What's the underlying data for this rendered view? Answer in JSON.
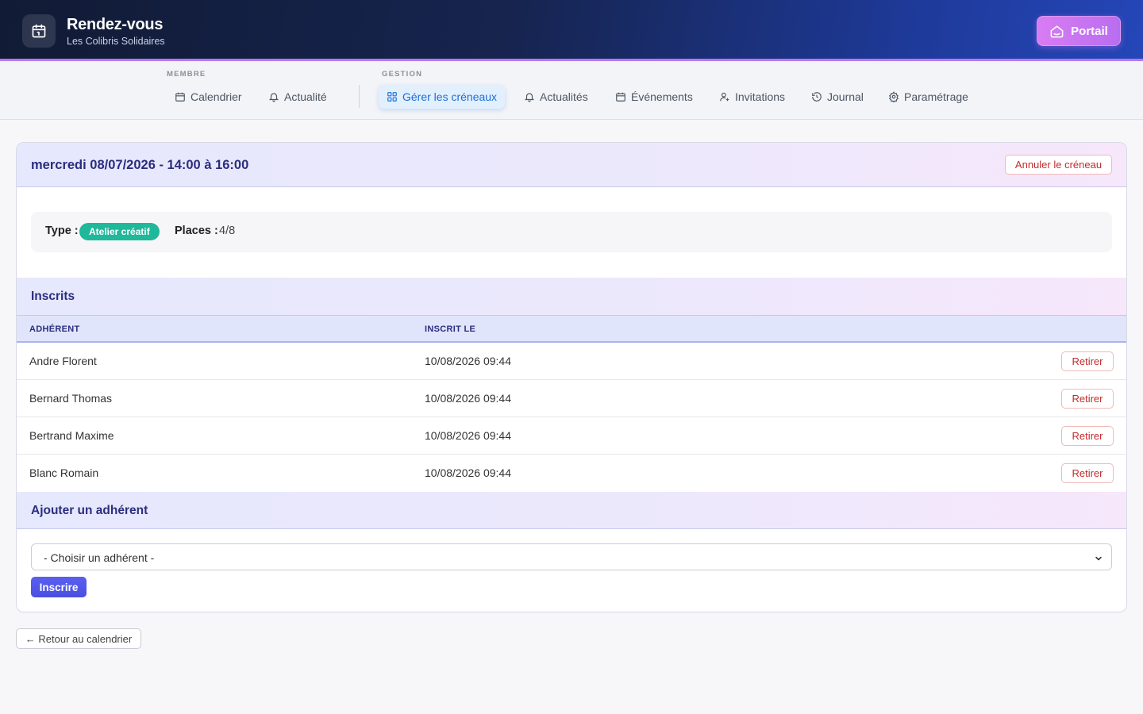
{
  "header": {
    "title": "Rendez-vous",
    "subtitle": "Les Colibris Solidaires",
    "portal_label": "Portail",
    "brand_icon": "calendar-icon",
    "portal_icon": "home-icon"
  },
  "nav": {
    "groups": [
      {
        "label": "MEMBRE"
      },
      {
        "label": "GESTION"
      }
    ],
    "items": [
      {
        "label": "Calendrier",
        "icon": "calendar-icon",
        "active": false
      },
      {
        "label": "Actualité",
        "icon": "bell-icon",
        "active": false
      },
      {
        "label": "Gérer les créneaux",
        "icon": "grid-icon",
        "active": true
      },
      {
        "label": "Actualités",
        "icon": "bell-icon",
        "active": false
      },
      {
        "label": "Événements",
        "icon": "calendar-icon",
        "active": false
      },
      {
        "label": "Invitations",
        "icon": "user-plus-icon",
        "active": false
      },
      {
        "label": "Journal",
        "icon": "history-icon",
        "active": false
      },
      {
        "label": "Paramétrage",
        "icon": "gear-icon",
        "active": false
      }
    ]
  },
  "slot": {
    "title": "mercredi 08/07/2026 - 14:00 à 16:00",
    "cancel_label": "Annuler le créneau",
    "type_label": "Type :",
    "type_value": "Atelier créatif",
    "places_label": "Places :",
    "places_value": "4/8"
  },
  "registrants": {
    "section_title": "Inscrits",
    "columns": [
      "ADHÉRENT",
      "INSCRIT LE"
    ],
    "remove_label": "Retirer",
    "rows": [
      {
        "name": "Andre Florent",
        "date": "10/08/2026 09:44"
      },
      {
        "name": "Bernard Thomas",
        "date": "10/08/2026 09:44"
      },
      {
        "name": "Bertrand Maxime",
        "date": "10/08/2026 09:44"
      },
      {
        "name": "Blanc Romain",
        "date": "10/08/2026 09:44"
      }
    ]
  },
  "add_member": {
    "section_title": "Ajouter un adhérent",
    "select_value": "- Choisir un adhérent -",
    "submit_label": "Inscrire"
  },
  "back_label": "← Retour au calendrier",
  "colors": {
    "accent": "#4a4fe0",
    "badge": "#1fb89a",
    "danger": "#c42b2b",
    "header_border": "#b678f0"
  }
}
